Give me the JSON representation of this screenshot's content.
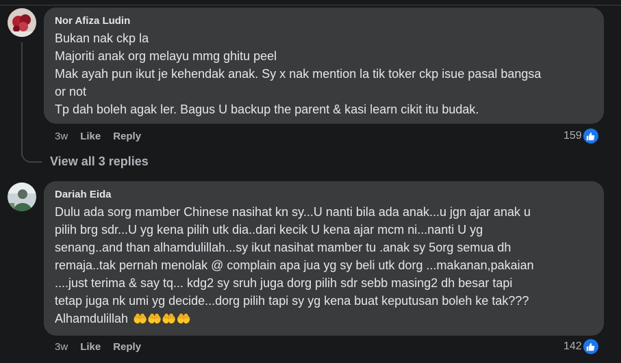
{
  "comments": [
    {
      "author": "Nor Afiza Ludin",
      "lines": [
        "Bukan nak ckp la",
        "Majoriti anak org melayu mmg ghitu peel",
        "Mak ayah pun ikut je kehendak anak. Sy x nak mention la tik toker ckp isue pasal bangsa",
        "or not",
        "Tp dah boleh agak ler. Bagus U backup the parent & kasi learn cikit itu budak."
      ],
      "time": "3w",
      "like_label": "Like",
      "reply_label": "Reply",
      "reaction_count": "159",
      "reaction_icon": "thumbs-up-icon",
      "view_replies": "View all 3 replies"
    },
    {
      "author": "Dariah Eida",
      "lines": [
        "Dulu ada sorg mamber Chinese nasihat kn sy...U nanti bila ada anak...u jgn ajar anak u",
        "pilih brg sdr...U yg kena pilih utk dia..dari kecik U kena ajar mcm ni...nanti U yg",
        "senang..and than alhamdulillah...sy ikut nasihat mamber tu .anak sy 5org semua dh",
        "remaja..tak pernah menolak @ complain apa jua yg sy beli utk dorg ...makanan,pakaian",
        "....just terima & say tq... kdg2 sy sruh juga dorg pilih sdr sebb masing2 dh besar tapi",
        "tetap juga nk umi yg decide...dorg pilih tapi sy yg kena buat keputusan boleh ke tak???"
      ],
      "last_line": "Alhamdulillah",
      "emoji": "🤲🤲🤲🤲",
      "time": "3w",
      "like_label": "Like",
      "reply_label": "Reply",
      "reaction_count": "142",
      "reaction_icon": "thumbs-up-icon"
    }
  ],
  "colors": {
    "background": "#18191a",
    "bubble": "#3a3b3c",
    "accent": "#1877f2",
    "muted": "#b0b3b8"
  }
}
